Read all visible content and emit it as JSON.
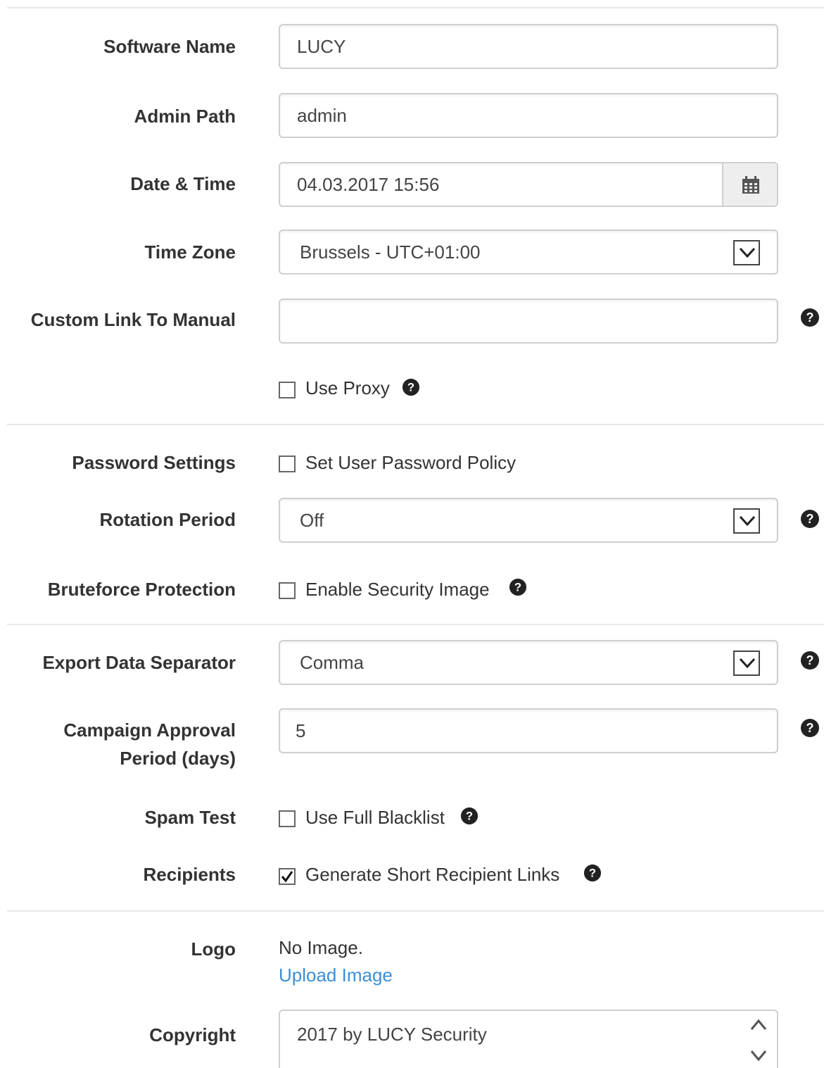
{
  "fields": {
    "software_name": {
      "label": "Software Name",
      "value": "LUCY"
    },
    "admin_path": {
      "label": "Admin Path",
      "value": "admin"
    },
    "date_time": {
      "label": "Date & Time",
      "value": "04.03.2017 15:56",
      "addon_icon": "calendar-icon"
    },
    "time_zone": {
      "label": "Time Zone",
      "value": "Brussels - UTC+01:00"
    },
    "custom_link": {
      "label": "Custom Link To Manual",
      "value": ""
    },
    "use_proxy": {
      "label": "Use Proxy",
      "checked": false
    },
    "password_settings": {
      "label": "Password Settings",
      "checkbox_label": "Set User Password Policy",
      "checked": false
    },
    "rotation_period": {
      "label": "Rotation Period",
      "value": "Off"
    },
    "bruteforce": {
      "label": "Bruteforce Protection",
      "checkbox_label": "Enable Security Image",
      "checked": false
    },
    "export_separator": {
      "label": "Export Data Separator",
      "value": "Comma"
    },
    "campaign_approval": {
      "label_line1": "Campaign Approval",
      "label_line2": "Period (days)",
      "value": "5"
    },
    "spam_test": {
      "label": "Spam Test",
      "checkbox_label": "Use Full Blacklist",
      "checked": false
    },
    "recipients": {
      "label": "Recipients",
      "checkbox_label": "Generate Short Recipient Links",
      "checked": true
    },
    "logo": {
      "label": "Logo",
      "status": "No Image.",
      "upload_link": "Upload Image"
    },
    "copyright": {
      "label": "Copyright",
      "value": "2017 by LUCY Security"
    }
  },
  "colors": {
    "link": "#3d8fd6",
    "border": "#cfcfcf",
    "label": "#333333"
  }
}
